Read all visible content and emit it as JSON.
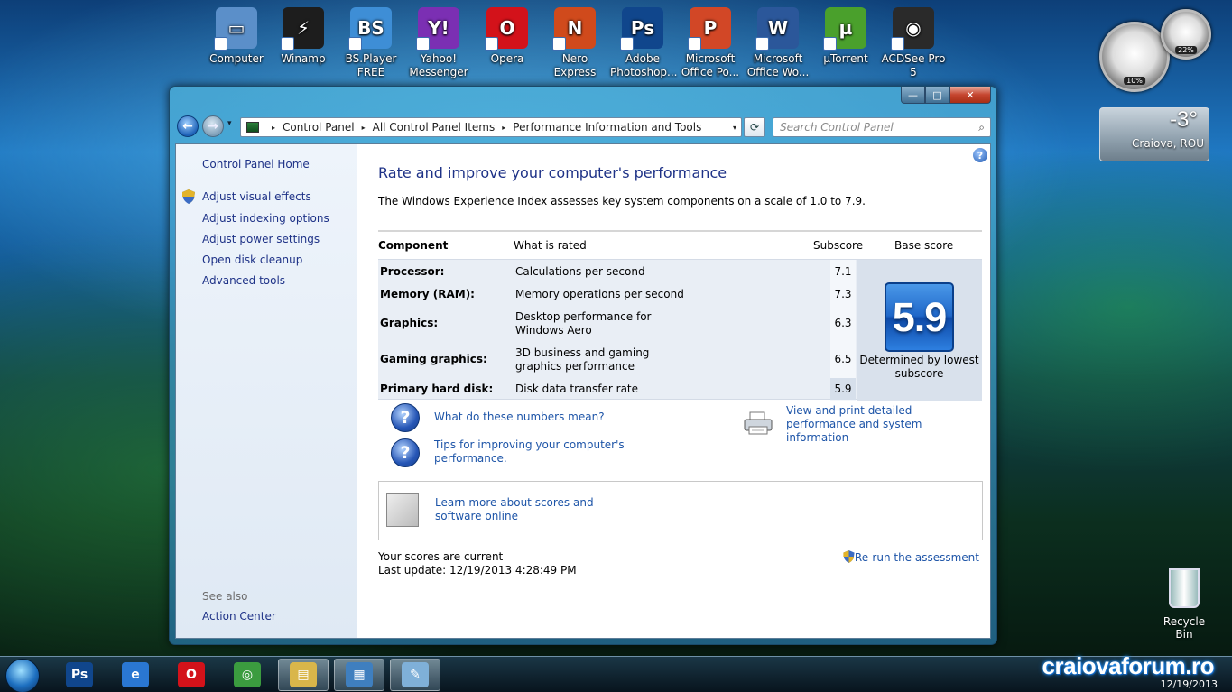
{
  "desktop": {
    "icons": [
      {
        "name": "Computer",
        "line2": "",
        "color": "#5b8fc9",
        "glyph": "▭"
      },
      {
        "name": "Winamp",
        "line2": "",
        "color": "#1d1d1d",
        "glyph": "⚡"
      },
      {
        "name": "BS.Player",
        "line2": "FREE",
        "color": "#3e8ed6",
        "glyph": "BS"
      },
      {
        "name": "Yahoo!",
        "line2": "Messenger",
        "color": "#7b2fb3",
        "glyph": "Y!"
      },
      {
        "name": "Opera",
        "line2": "",
        "color": "#d3121a",
        "glyph": "O"
      },
      {
        "name": "Nero Express",
        "line2": "",
        "color": "#d04a1c",
        "glyph": "N"
      },
      {
        "name": "Adobe",
        "line2": "Photoshop...",
        "color": "#10468c",
        "glyph": "Ps"
      },
      {
        "name": "Microsoft",
        "line2": "Office Po...",
        "color": "#d24726",
        "glyph": "P"
      },
      {
        "name": "Microsoft",
        "line2": "Office Wo...",
        "color": "#2b579a",
        "glyph": "W"
      },
      {
        "name": "µTorrent",
        "line2": "",
        "color": "#4aa02c",
        "glyph": "µ"
      },
      {
        "name": "ACDSee Pro",
        "line2": "5",
        "color": "#2a2a2a",
        "glyph": "◉"
      }
    ],
    "gadget_cpu": {
      "cpu_pct": "10%",
      "mem_pct": "22%"
    },
    "weather": {
      "temp": "-3°",
      "city": "Craiova, ROU"
    },
    "recycle_bin": "Recycle Bin",
    "watermark": "craiovaforum.ro"
  },
  "window": {
    "buttons": {
      "minimize": "—",
      "maximize": "□",
      "close": "✕"
    },
    "nav": {
      "back": "←",
      "forward": "→",
      "recent_drop": "▾"
    },
    "address": {
      "crumbs": [
        "Control Panel",
        "All Control Panel Items",
        "Performance Information and Tools"
      ],
      "separator": "▸",
      "drop": "▾"
    },
    "refresh": "⟳",
    "search": {
      "placeholder": "Search Control Panel",
      "icon": "⌕"
    }
  },
  "sidebar": {
    "home": "Control Panel Home",
    "links": [
      "Adjust visual effects",
      "Adjust indexing options",
      "Adjust power settings",
      "Open disk cleanup",
      "Advanced tools"
    ],
    "see_also": "See also",
    "action_center": "Action Center"
  },
  "main": {
    "help": "?",
    "title": "Rate and improve your computer's performance",
    "description": "The Windows Experience Index assesses key system components on a scale of 1.0 to 7.9.",
    "table": {
      "headers": {
        "component": "Component",
        "what": "What is rated",
        "subscore": "Subscore",
        "base": "Base score"
      },
      "rows": [
        {
          "component": "Processor:",
          "what": "Calculations per second",
          "subscore": "7.1"
        },
        {
          "component": "Memory (RAM):",
          "what": "Memory operations per second",
          "subscore": "7.3"
        },
        {
          "component": "Graphics:",
          "what": "Desktop performance for Windows Aero",
          "subscore": "6.3"
        },
        {
          "component": "Gaming graphics:",
          "what": "3D business and gaming graphics performance",
          "subscore": "6.5"
        },
        {
          "component": "Primary hard disk:",
          "what": "Disk data transfer rate",
          "subscore": "5.9"
        }
      ],
      "base_score": "5.9",
      "base_caption": "Determined by lowest subscore"
    },
    "links": {
      "numbers_mean": "What do these numbers mean?",
      "tips": "Tips for improving your computer's performance.",
      "print": "View and print detailed performance and system information",
      "learn_more": "Learn more about scores and software online"
    },
    "status": "Your scores are current",
    "last_update": "Last update: 12/19/2013 4:28:49 PM",
    "rerun": "Re-run the assessment"
  },
  "taskbar": {
    "items": [
      {
        "name": "photoshop",
        "color": "#10468c",
        "glyph": "Ps",
        "active": false
      },
      {
        "name": "internet-explorer",
        "color": "#2a77d2",
        "glyph": "e",
        "active": false
      },
      {
        "name": "opera",
        "color": "#d3121a",
        "glyph": "O",
        "active": false
      },
      {
        "name": "chrome",
        "color": "#3b9c3f",
        "glyph": "◎",
        "active": false
      },
      {
        "name": "explorer",
        "color": "#d9b64a",
        "glyph": "▤",
        "active": true
      },
      {
        "name": "control-panel",
        "color": "#3f7fbf",
        "glyph": "▦",
        "active": true
      },
      {
        "name": "paint",
        "color": "#7fb0d8",
        "glyph": "✎",
        "active": true
      }
    ],
    "clock": "12/19/2013"
  }
}
